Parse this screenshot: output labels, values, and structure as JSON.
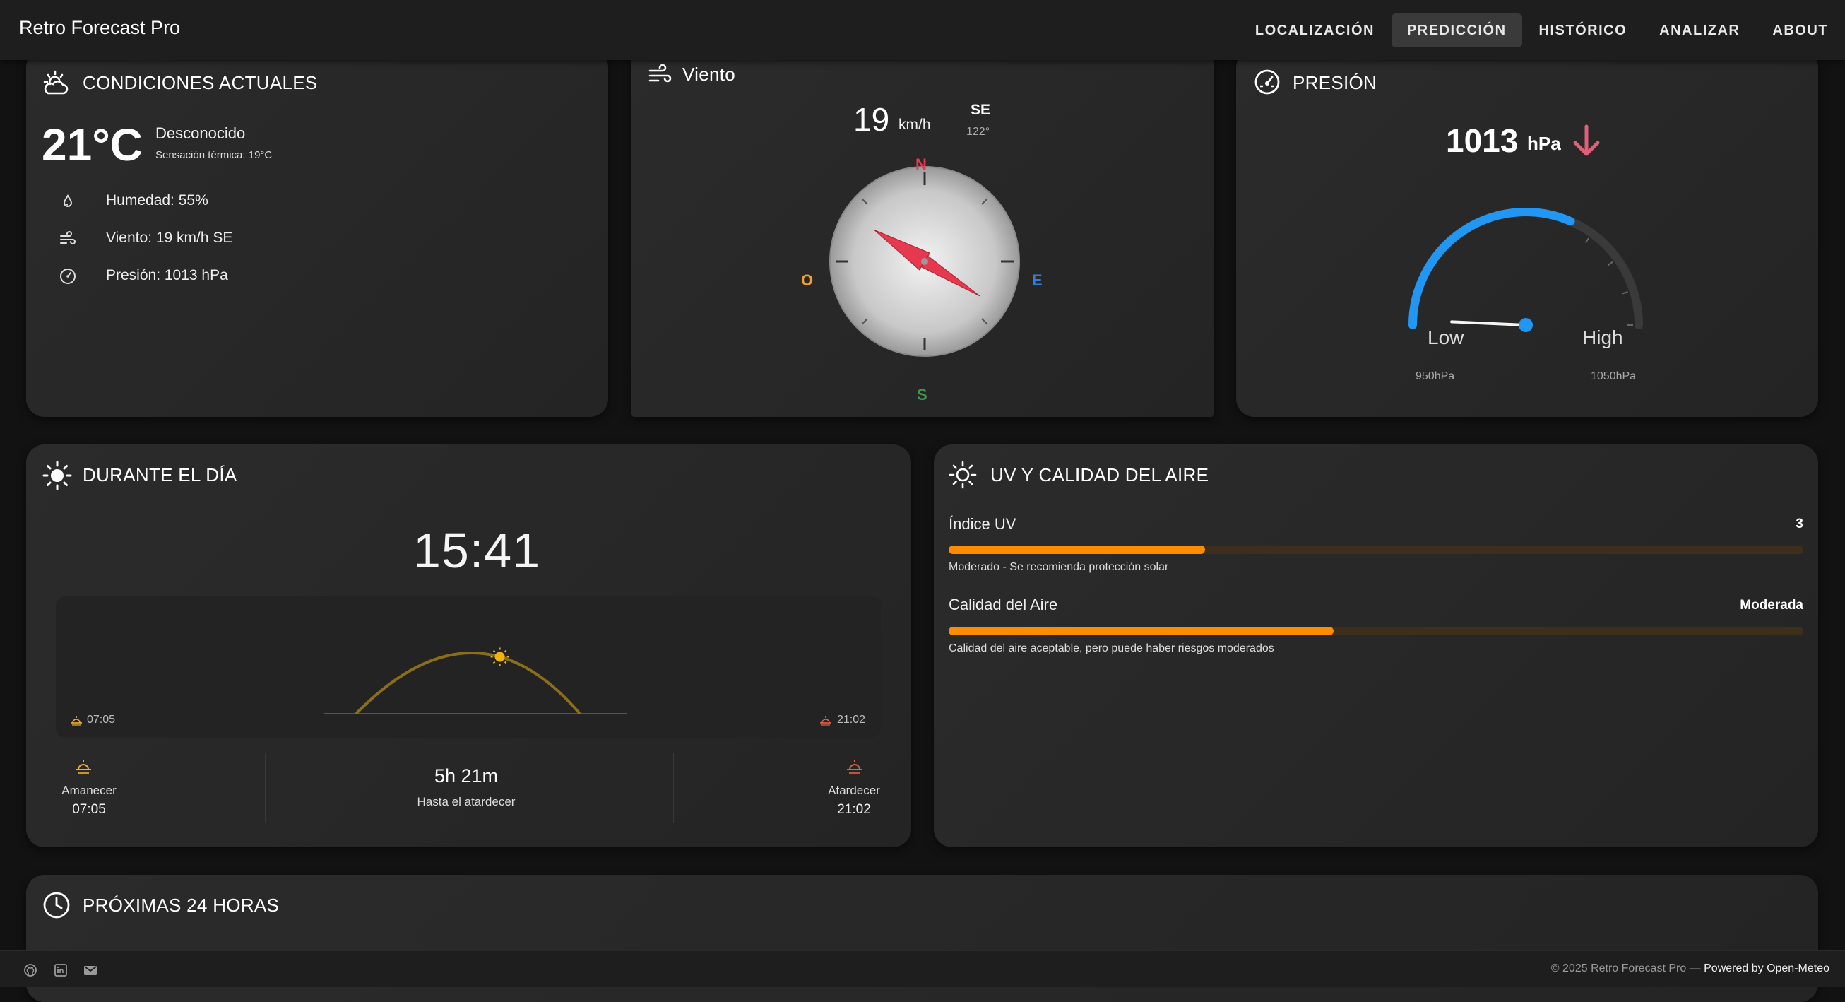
{
  "app": {
    "title": "Retro Forecast Pro"
  },
  "nav": {
    "items": [
      {
        "label": "LOCALIZACIÓN"
      },
      {
        "label": "PREDICCIÓN",
        "active": true
      },
      {
        "label": "HISTÓRICO"
      },
      {
        "label": "ANALIZAR"
      },
      {
        "label": "ABOUT"
      }
    ]
  },
  "current": {
    "title": "CONDICIONES ACTUALES",
    "temp": "21°C",
    "condition": "Desconocido",
    "feels_like": "Sensación térmica: 19°C",
    "humidity": "Humedad: 55%",
    "wind": "Viento: 19 km/h SE",
    "pressure": "Presión: 1013 hPa"
  },
  "wind": {
    "title": "Viento",
    "speed": "19",
    "unit": "km/h",
    "dir": "SE",
    "deg": "122°",
    "deg_value": 122,
    "n": "N",
    "e": "E",
    "s": "S",
    "o": "O",
    "colors": {
      "n": "#e53950",
      "e": "#3a7bd5",
      "s": "#3a9a4a",
      "o": "#f0a030"
    }
  },
  "pressure": {
    "title": "PRESIÓN",
    "value": "1013",
    "unit": "hPa",
    "trend": "falling",
    "low_label": "Low",
    "high_label": "High",
    "min_label": "950hPa",
    "max_label": "1050hPa",
    "min": 950,
    "max": 1050,
    "current": 1013
  },
  "day": {
    "title": "DURANTE EL DÍA",
    "time": "15:41",
    "sunrise_chart": "07:05",
    "sunset_chart": "21:02",
    "sunrise_label": "Amanecer",
    "sunrise_time": "07:05",
    "remaining": "5h 21m",
    "remaining_label": "Hasta el atardecer",
    "sunset_label": "Atardecer",
    "sunset_time": "21:02",
    "sun_progress": 0.62
  },
  "uv": {
    "title": "UV Y CALIDAD DEL AIRE",
    "uv_label": "Índice UV",
    "uv_value": "3",
    "uv_fraction": 0.3,
    "uv_desc": "Moderado - Se recomienda protección solar",
    "air_label": "Calidad del Aire",
    "air_value": "Moderada",
    "air_fraction": 0.45,
    "air_desc": "Calidad del aire aceptable, pero puede haber riesgos moderados",
    "accent": "#ff8c00"
  },
  "next24": {
    "title": "PRÓXIMAS 24 HORAS"
  },
  "footer": {
    "copyright": "© 2025 Retro Forecast Pro — ",
    "powered": "Powered by Open-Meteo"
  }
}
